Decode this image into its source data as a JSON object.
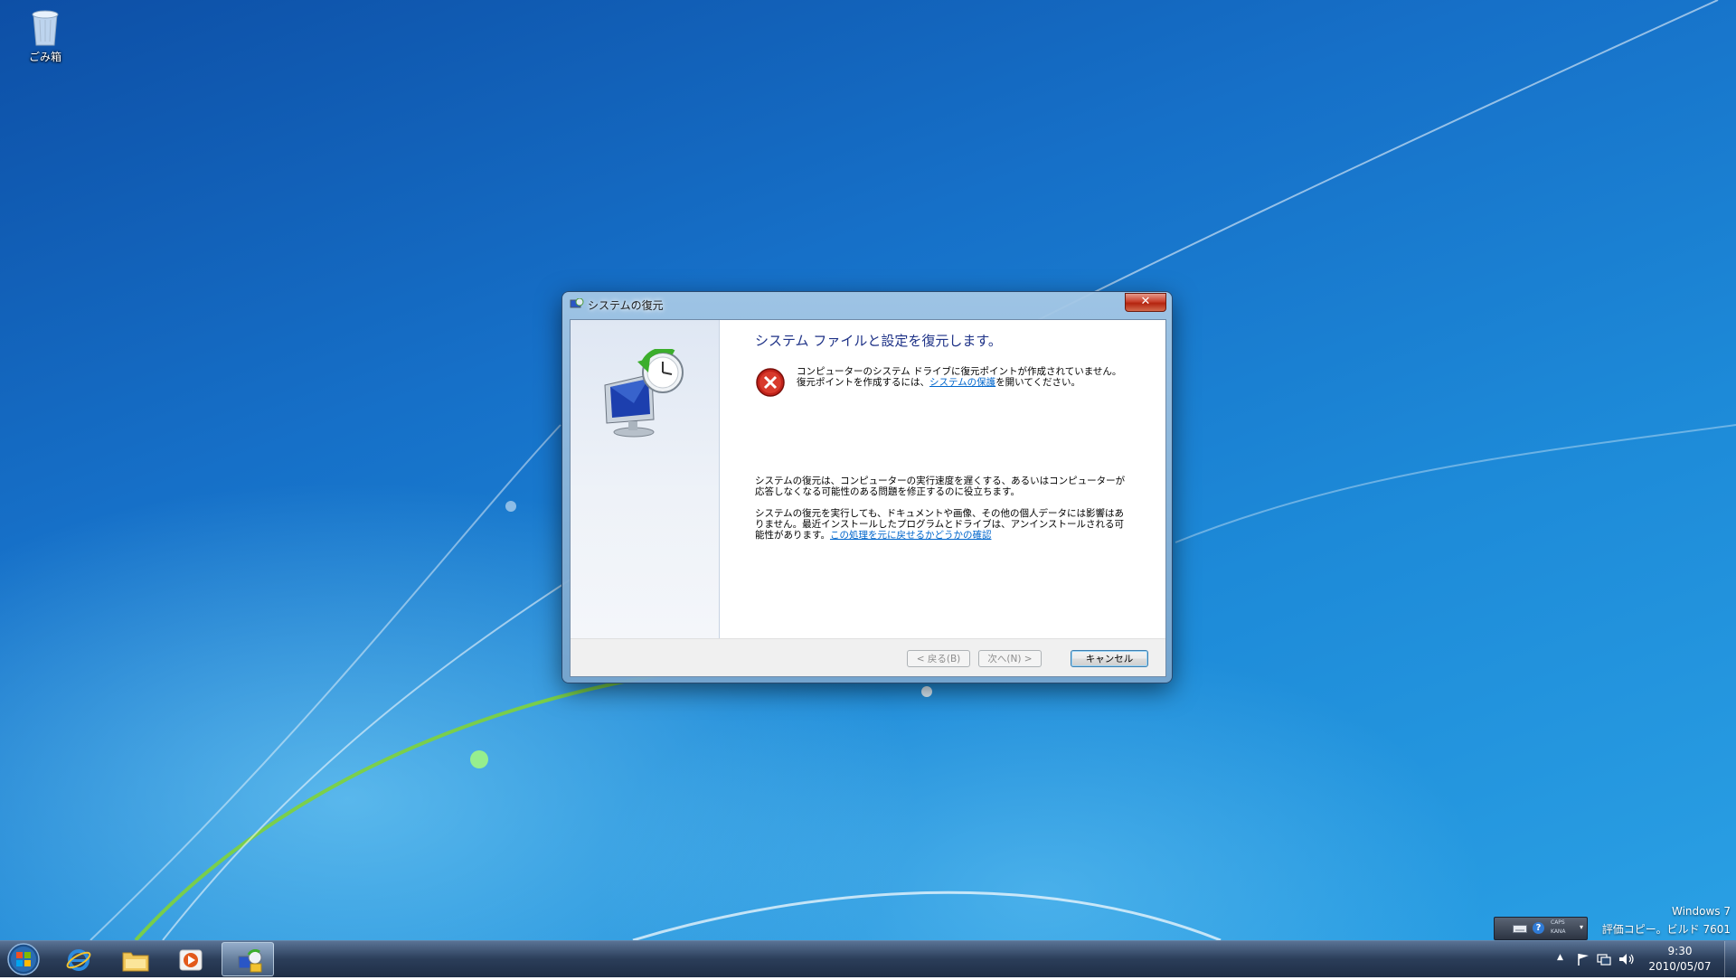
{
  "desktop": {
    "recycle_bin_label": "ごみ箱",
    "watermark": {
      "line1": "Windows 7",
      "line2": "評価コピー。ビルド 7601"
    }
  },
  "dialog": {
    "title": "システムの復元",
    "close_icon": "close-x-icon",
    "heading": "システム ファイルと設定を復元します。",
    "error": {
      "icon": "error-x-icon",
      "text_before_link": "コンピューターのシステム ドライブに復元ポイントが作成されていません。復元ポイントを作成するには、",
      "link": "システムの保護",
      "text_after_link": "を開いてください。"
    },
    "paragraph1": "システムの復元は、コンピューターの実行速度を遅くする、あるいはコンピューターが応答しなくなる可能性のある問題を修正するのに役立ちます。",
    "paragraph2": {
      "text": "システムの復元を実行しても、ドキュメントや画像、その他の個人データには影響はありません。最近インストールしたプログラムとドライブは、アンインストールされる可能性があります。",
      "link": "この処理を元に戻せるかどうかの確認"
    },
    "buttons": {
      "back": "< 戻る(B)",
      "next": "次へ(N) >",
      "cancel": "キャンセル"
    }
  },
  "langbar": {
    "caps": "CAPS",
    "kana": "KANA"
  },
  "taskbar": {
    "items": [
      "start-orb",
      "internet-explorer",
      "windows-explorer",
      "media-player",
      "system-restore"
    ],
    "clock": {
      "time": "9:30",
      "date": "2010/05/07"
    }
  }
}
